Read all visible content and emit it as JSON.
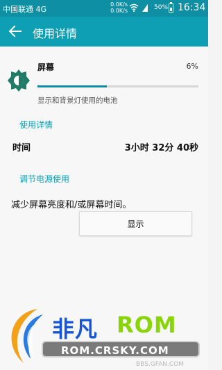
{
  "status_bar": {
    "carrier": "中国联通 4G",
    "net_up": "0.0K/s",
    "net_down": "0.0K/s",
    "battery_pct": "50%",
    "clock": "16:34",
    "wifi_icon": "wifi-icon",
    "battery_icon": "battery-icon"
  },
  "app_bar": {
    "title": "使用详情",
    "back_icon": "back-arrow-icon"
  },
  "screen": {
    "label": "屏幕",
    "percent": "6%",
    "progress_fraction": 0.43,
    "description": "显示和背景灯使用的电池",
    "icon": "brightness-icon"
  },
  "usage_section": {
    "header": "使用详情",
    "time_label": "时间",
    "time_value": "3小时 32分 40秒"
  },
  "power_section": {
    "header": "调节电源使用",
    "tip": "减少屏幕亮度和/或屏幕时间。",
    "button_label": "显示"
  },
  "watermark": {
    "brand": "非凡",
    "brand_suffix": "ROM",
    "url": "ROM.CRSKY.COM",
    "bbs": "BBS.GFAN.COM"
  },
  "colors": {
    "status_bar": "#0e8fa3",
    "app_bar": "#0e9fb4",
    "accent": "#0b8ea3",
    "icon_green": "#1f7a66"
  }
}
